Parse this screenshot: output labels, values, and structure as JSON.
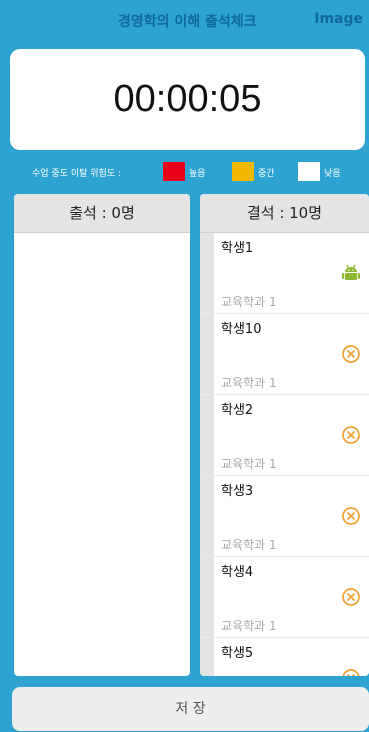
{
  "header": {
    "title": "경영학의 이해 출석체크",
    "image_button": "Image"
  },
  "timer": {
    "elapsed": "00:00:05"
  },
  "risk_legend": {
    "label": "수업 중도 이탈 위험도 :",
    "levels": [
      {
        "label": "높음",
        "color": "#e8001b"
      },
      {
        "label": "중간",
        "color": "#f5b800"
      },
      {
        "label": "낮음",
        "color": "#ffffff"
      }
    ]
  },
  "attendance_panel": {
    "header": "출석 : 0명"
  },
  "absence_panel": {
    "header": "결석 : 10명",
    "students": [
      {
        "name": "학생1",
        "dept": "교육학과 1",
        "icon": "android-icon"
      },
      {
        "name": "학생10",
        "dept": "교육학과 1",
        "icon": "absent-x-icon"
      },
      {
        "name": "학생2",
        "dept": "교육학과 1",
        "icon": "absent-x-icon"
      },
      {
        "name": "학생3",
        "dept": "교육학과 1",
        "icon": "absent-x-icon"
      },
      {
        "name": "학생4",
        "dept": "교육학과 1",
        "icon": "absent-x-icon"
      },
      {
        "name": "학생5",
        "dept": "",
        "icon": "absent-x-icon"
      }
    ]
  },
  "save_button": {
    "label": "저 장"
  },
  "colors": {
    "background": "#2ea3d2",
    "header_text": "#0d6a9a",
    "absent_icon": "#f0a030",
    "android_icon": "#8bb830"
  }
}
